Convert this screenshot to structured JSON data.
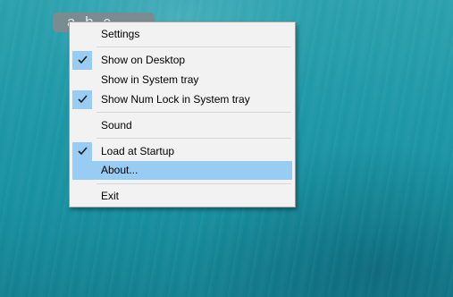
{
  "widget": {
    "text": "a b c"
  },
  "menu": {
    "items": [
      {
        "label": "Settings",
        "checked": false,
        "highlighted": false
      },
      {
        "label": "Show on Desktop",
        "checked": true,
        "highlighted": false
      },
      {
        "label": "Show in System tray",
        "checked": false,
        "highlighted": false
      },
      {
        "label": "Show Num Lock in System tray",
        "checked": true,
        "highlighted": false
      },
      {
        "label": "Sound",
        "checked": false,
        "highlighted": false
      },
      {
        "label": "Load at Startup",
        "checked": true,
        "highlighted": false
      },
      {
        "label": "About...",
        "checked": false,
        "highlighted": true
      },
      {
        "label": "Exit",
        "checked": false,
        "highlighted": false
      }
    ]
  },
  "icons": {
    "check": "checkmark-icon"
  },
  "colors": {
    "highlight": "#99ccf2",
    "menu_bg": "#f2f2f2",
    "desktop": "#1c96a6"
  }
}
